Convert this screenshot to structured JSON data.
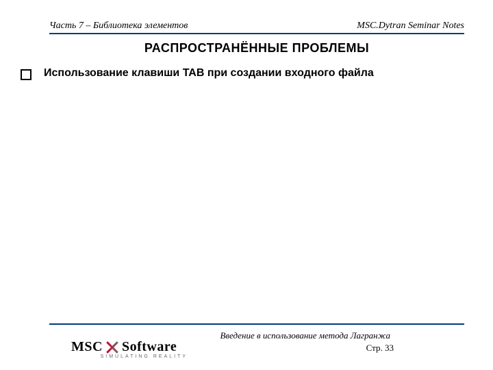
{
  "header": {
    "left": "Часть 7 – Библиотека элементов",
    "right": "MSC.Dytran Seminar Notes"
  },
  "title": "РАСПРОСТРАНЁННЫЕ ПРОБЛЕМЫ",
  "bullets": [
    {
      "text": "Использование клавиши TAB при создании входного файла"
    }
  ],
  "logo": {
    "brand_left": "MSC",
    "brand_right": "Software",
    "tagline": "SIMULATING REALITY"
  },
  "footer": {
    "subtitle": "Введение в использование метода Лагранжа",
    "page_label": "Стр. 33"
  }
}
